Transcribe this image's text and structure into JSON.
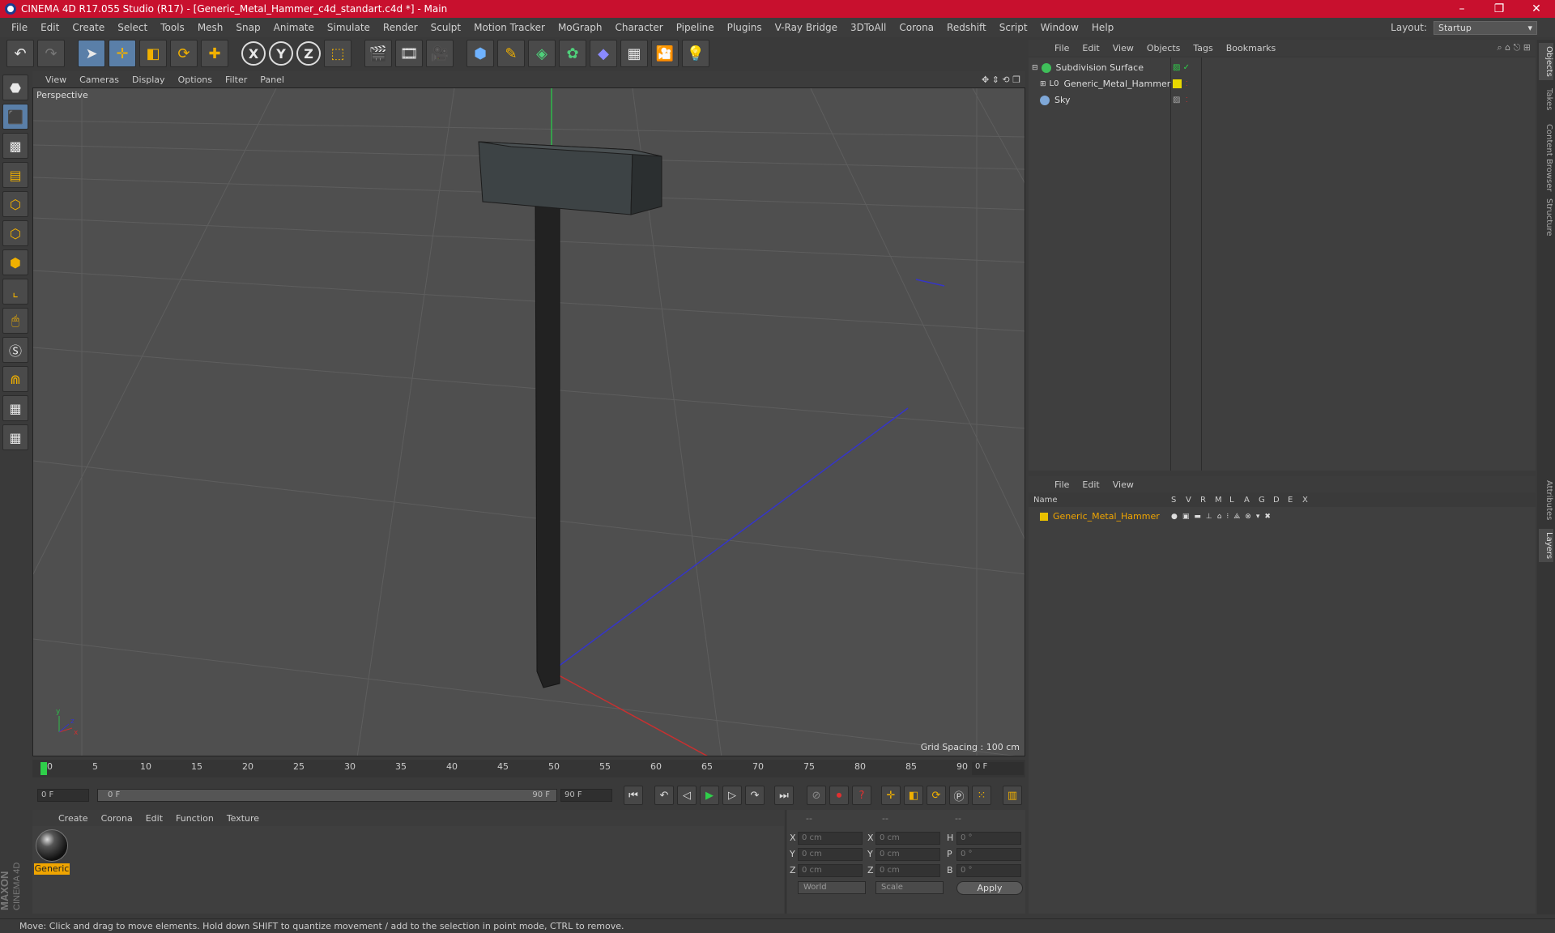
{
  "window": {
    "title": "CINEMA 4D R17.055 Studio (R17) - [Generic_Metal_Hammer_c4d_standart.c4d *] - Main"
  },
  "menubar": {
    "items": [
      "File",
      "Edit",
      "Create",
      "Select",
      "Tools",
      "Mesh",
      "Snap",
      "Animate",
      "Simulate",
      "Render",
      "Sculpt",
      "Motion Tracker",
      "MoGraph",
      "Character",
      "Pipeline",
      "Plugins",
      "V-Ray Bridge",
      "3DToAll",
      "Corona",
      "Redshift",
      "Script",
      "Window",
      "Help"
    ],
    "layout_label": "Layout:",
    "layout_value": "Startup"
  },
  "toolbar": {
    "axis_x": "X",
    "axis_y": "Y",
    "axis_z": "Z"
  },
  "viewport": {
    "menu": [
      "View",
      "Cameras",
      "Display",
      "Options",
      "Filter",
      "Panel"
    ],
    "label": "Perspective",
    "grid_spacing": "Grid Spacing : 100 cm"
  },
  "timeline": {
    "ticks": [
      "0",
      "5",
      "10",
      "15",
      "20",
      "25",
      "30",
      "35",
      "40",
      "45",
      "50",
      "55",
      "60",
      "65",
      "70",
      "75",
      "80",
      "85",
      "90"
    ],
    "current_frame": "0 F",
    "start_field": "0 F",
    "range_start": "0 F",
    "range_end": "90 F",
    "end_field": "90 F"
  },
  "material_manager": {
    "menu": [
      "Create",
      "Corona",
      "Edit",
      "Function",
      "Texture"
    ],
    "materials": [
      {
        "name": "Generic"
      }
    ]
  },
  "coordinates": {
    "header": [
      "--",
      "--",
      "--"
    ],
    "rows": [
      {
        "l1": "X",
        "v1": "0 cm",
        "l2": "X",
        "v2": "0 cm",
        "l3": "H",
        "v3": "0 °"
      },
      {
        "l1": "Y",
        "v1": "0 cm",
        "l2": "Y",
        "v2": "0 cm",
        "l3": "P",
        "v3": "0 °"
      },
      {
        "l1": "Z",
        "v1": "0 cm",
        "l2": "Z",
        "v2": "0 cm",
        "l3": "B",
        "v3": "0 °"
      }
    ],
    "space": "World",
    "mode": "Scale",
    "apply": "Apply"
  },
  "object_manager": {
    "menu": [
      "File",
      "Edit",
      "View",
      "Objects",
      "Tags",
      "Bookmarks"
    ],
    "objects": [
      {
        "name": "Subdivision Surface",
        "color": "#3fbf5a"
      },
      {
        "name": "Generic_Metal_Hammer",
        "color": "#d8d8d8"
      },
      {
        "name": "Sky",
        "color": "#7fa8d8"
      }
    ]
  },
  "layer_manager": {
    "menu": [
      "File",
      "Edit",
      "View"
    ],
    "columns": [
      "Name",
      "S",
      "V",
      "R",
      "M",
      "L",
      "A",
      "G",
      "D",
      "E",
      "X"
    ],
    "layers": [
      {
        "name": "Generic_Metal_Hammer",
        "color": "#e8c000"
      }
    ]
  },
  "right_tabs": [
    "Objects",
    "Takes",
    "Content Browser",
    "Structure",
    "Attributes",
    "Layers"
  ],
  "status": {
    "text": "Move: Click and drag to move elements. Hold down SHIFT to quantize movement / add to the selection in point mode, CTRL to remove."
  },
  "brand": {
    "line1": "MAXON",
    "line2": "CINEMA 4D"
  }
}
